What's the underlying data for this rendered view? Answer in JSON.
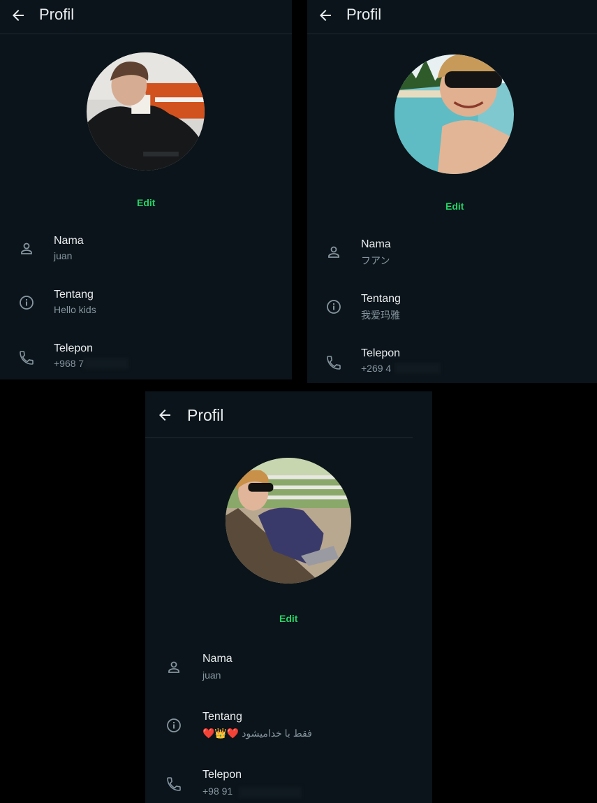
{
  "colors": {
    "background": "#0b141a",
    "accent": "#25d366",
    "text": "#e9edef",
    "muted": "#8696a0"
  },
  "panels": [
    {
      "title": "Profil",
      "edit_label": "Edit",
      "name": {
        "label": "Nama",
        "value": "juan"
      },
      "about": {
        "label": "Tentang",
        "value": "Hello kids"
      },
      "phone": {
        "label": "Telepon",
        "value": "+968 7"
      }
    },
    {
      "title": "Profil",
      "edit_label": "Edit",
      "name": {
        "label": "Nama",
        "value": "フアン"
      },
      "about": {
        "label": "Tentang",
        "value": "我爱玛雅"
      },
      "phone": {
        "label": "Telepon",
        "value": "+269 4"
      }
    },
    {
      "title": "Profil",
      "edit_label": "Edit",
      "name": {
        "label": "Nama",
        "value": "juan"
      },
      "about": {
        "label": "Tentang",
        "value": "❤️👑❤️ فقط با خدامیشود"
      },
      "phone": {
        "label": "Telepon",
        "value": "+98 91"
      }
    }
  ],
  "icons": {
    "back": "arrow-left-icon",
    "name": "person-icon",
    "about": "info-icon",
    "phone": "phone-icon"
  }
}
